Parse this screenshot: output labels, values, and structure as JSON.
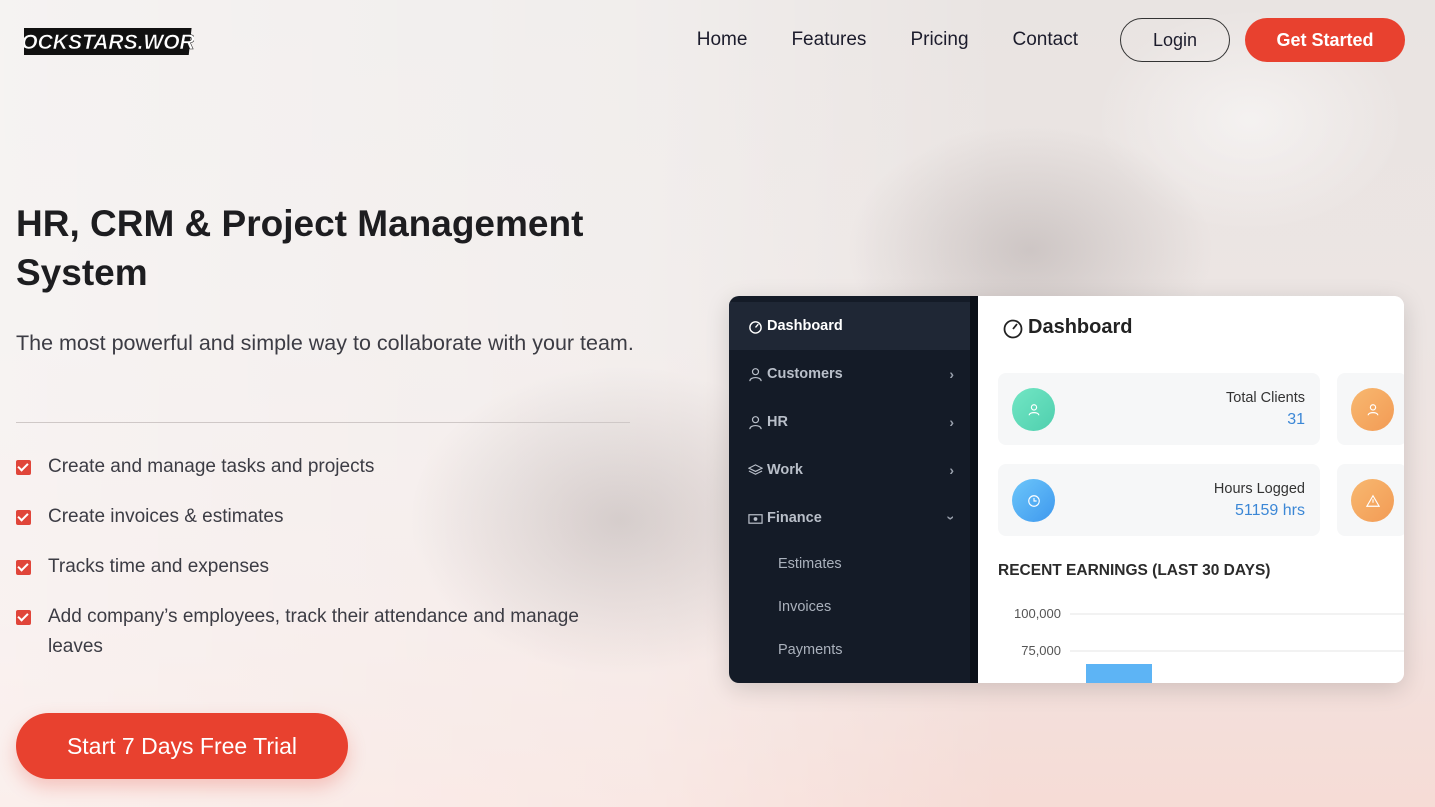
{
  "brand": {
    "logo_text": "ROCKSTARS.WORK"
  },
  "nav": {
    "links": [
      "Home",
      "Features",
      "Pricing",
      "Contact"
    ],
    "login_label": "Login",
    "get_started_label": "Get Started"
  },
  "hero": {
    "title": "HR, CRM & Project Management System",
    "subtitle": "The most powerful and simple way to collaborate with your team.",
    "features": [
      "Create and manage tasks and projects",
      "Create invoices & estimates",
      "Tracks time and expenses",
      "Add company’s employees, track their attendance and manage leaves"
    ],
    "cta_label": "Start 7 Days Free Trial"
  },
  "dashboard": {
    "sidebar": {
      "items": [
        {
          "label": "Dashboard",
          "icon": "gauge-icon"
        },
        {
          "label": "Customers",
          "icon": "user-icon"
        },
        {
          "label": "HR",
          "icon": "person-icon"
        },
        {
          "label": "Work",
          "icon": "layers-icon"
        },
        {
          "label": "Finance",
          "icon": "money-icon"
        }
      ],
      "finance_sub": [
        "Estimates",
        "Invoices",
        "Payments"
      ]
    },
    "title": "Dashboard",
    "cards": [
      {
        "label": "Total Clients",
        "value": "31",
        "color": "#56d9b2"
      },
      {
        "label": "Hours Logged",
        "value": "51159 hrs",
        "color": "#4aa8f0"
      }
    ],
    "partial_card_colors": [
      "#f6a560",
      "#f6a560"
    ],
    "earnings_title": "RECENT EARNINGS (LAST 30 DAYS)",
    "chart_data": {
      "type": "bar",
      "y_ticks": [
        "100,000",
        "75,000"
      ],
      "bar_color": "#5db4f5"
    }
  },
  "colors": {
    "accent": "#e8412f",
    "sidebar_bg": "#141b27"
  }
}
